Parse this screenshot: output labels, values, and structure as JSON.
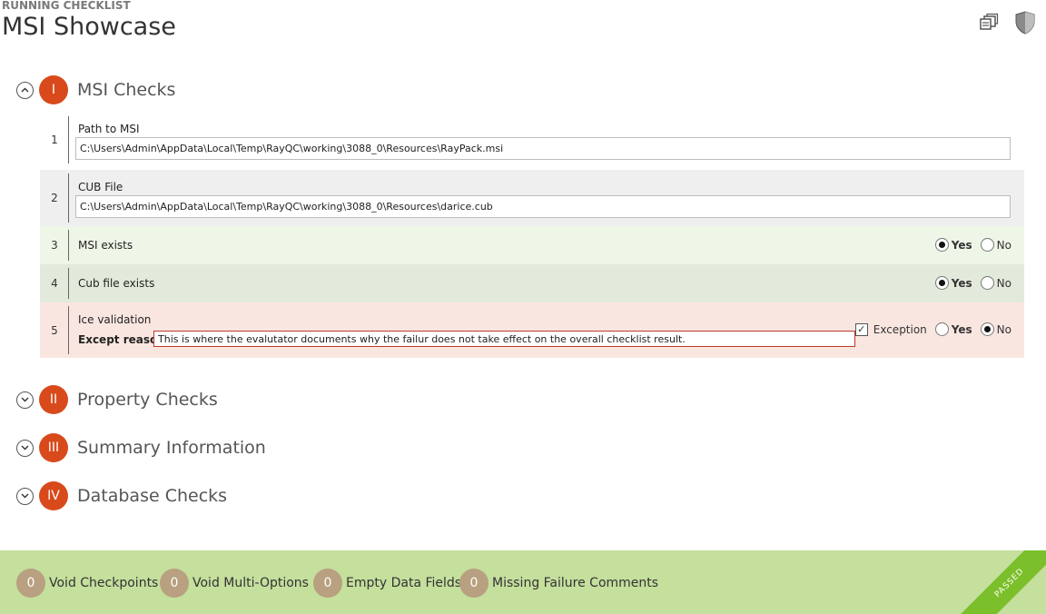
{
  "header": {
    "subtitle": "RUNNING CHECKLIST",
    "title": "MSI Showcase",
    "icons": [
      "restore-window-icon",
      "shield-icon"
    ]
  },
  "sections": [
    {
      "numeral": "I",
      "title": "MSI Checks",
      "expanded": true
    },
    {
      "numeral": "II",
      "title": "Property Checks",
      "expanded": false
    },
    {
      "numeral": "III",
      "title": "Summary Information",
      "expanded": false
    },
    {
      "numeral": "IV",
      "title": "Database Checks",
      "expanded": false
    }
  ],
  "checks": [
    {
      "num": "1",
      "label": "Path to MSI",
      "value": "C:\\Users\\Admin\\AppData\\Local\\Temp\\RayQC\\working\\3088_0\\Resources\\RayPack.msi"
    },
    {
      "num": "2",
      "label": "CUB File",
      "value": "C:\\Users\\Admin\\AppData\\Local\\Temp\\RayQC\\working\\3088_0\\Resources\\darice.cub"
    },
    {
      "num": "3",
      "label": "MSI exists",
      "selected": "Yes"
    },
    {
      "num": "4",
      "label": "Cub file exists",
      "selected": "Yes"
    },
    {
      "num": "5",
      "label": "Ice validation",
      "selected": "No",
      "exception_checked": true,
      "except_label": "Except reason",
      "except_value": "This is where the evalutator documents why the failur does not take effect on the overall checklist result."
    }
  ],
  "options": {
    "yes": "Yes",
    "no": "No",
    "exception": "Exception"
  },
  "footer": {
    "stats": [
      {
        "count": "0",
        "label": "Void Checkpoints"
      },
      {
        "count": "0",
        "label": "Void Multi-Options"
      },
      {
        "count": "0",
        "label": "Empty Data Fields"
      },
      {
        "count": "0",
        "label": "Missing Failure Comments"
      }
    ],
    "status": "PASSED"
  },
  "colors": {
    "accent": "#d84a1b",
    "row_gray": "#efefef",
    "row_green_light": "#eef6e8",
    "row_green": "#e2eadb",
    "row_red": "#fae6e1",
    "footer": "#c5df9d",
    "stat_circle": "#b8a080",
    "ribbon": "#7bbf2b"
  }
}
